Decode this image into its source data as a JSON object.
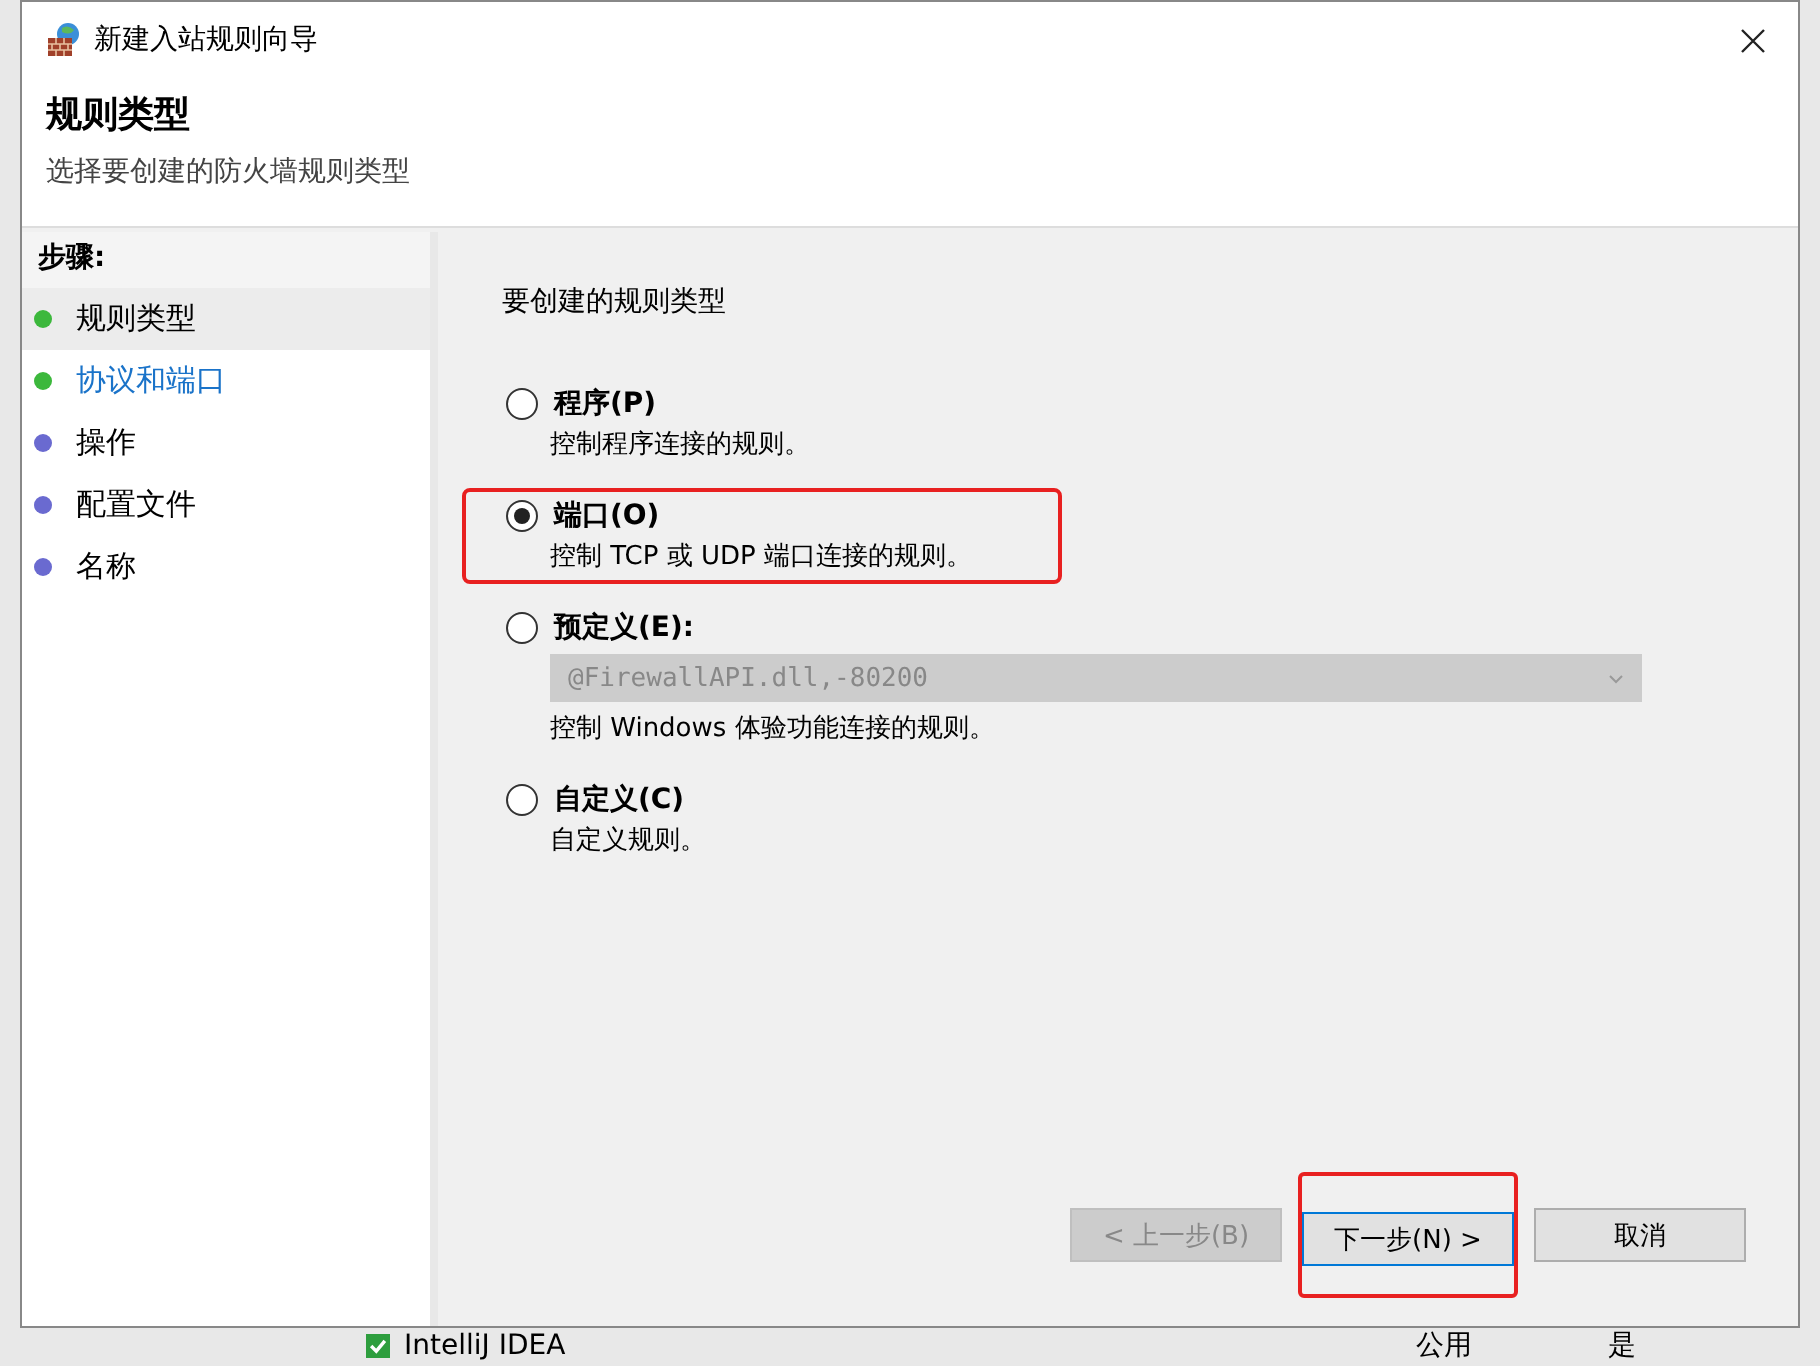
{
  "window": {
    "title": "新建入站规则向导"
  },
  "header": {
    "title": "规则类型",
    "subtitle": "选择要创建的防火墙规则类型"
  },
  "steps": {
    "heading": "步骤:",
    "items": [
      {
        "label": "规则类型",
        "color": "#3cb83c",
        "selected": true,
        "link": false
      },
      {
        "label": "协议和端口",
        "color": "#3cb83c",
        "selected": false,
        "link": true
      },
      {
        "label": "操作",
        "color": "#6a6ad0",
        "selected": false,
        "link": false
      },
      {
        "label": "配置文件",
        "color": "#6a6ad0",
        "selected": false,
        "link": false
      },
      {
        "label": "名称",
        "color": "#6a6ad0",
        "selected": false,
        "link": false
      }
    ]
  },
  "content": {
    "prompt": "要创建的规则类型",
    "options": [
      {
        "label": "程序(P)",
        "description": "控制程序连接的规则。",
        "selected": false,
        "highlighted": false
      },
      {
        "label": "端口(O)",
        "description": "控制 TCP 或 UDP 端口连接的规则。",
        "selected": true,
        "highlighted": true
      },
      {
        "label": "预定义(E):",
        "description": "控制 Windows 体验功能连接的规则。",
        "selected": false,
        "highlighted": false,
        "dropdown": {
          "value": "@FirewallAPI.dll,-80200",
          "disabled": true
        }
      },
      {
        "label": "自定义(C)",
        "description": "自定义规则。",
        "selected": false,
        "highlighted": false
      }
    ]
  },
  "buttons": [
    {
      "label": "< 上一步(B)",
      "disabled": true,
      "primary": false,
      "highlighted": false
    },
    {
      "label": "下一步(N) >",
      "disabled": false,
      "primary": true,
      "highlighted": true
    },
    {
      "label": "取消",
      "disabled": false,
      "primary": false,
      "highlighted": false
    }
  ],
  "background": {
    "row": {
      "name": "IntelliJ IDEA",
      "profile": "公用",
      "enabled": "是"
    }
  }
}
